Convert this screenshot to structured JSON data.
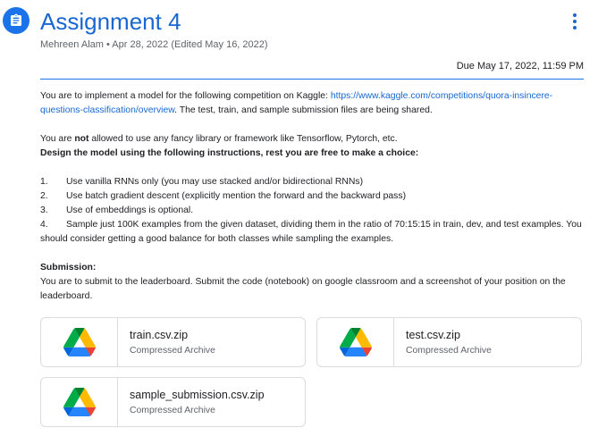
{
  "header": {
    "title": "Assignment 4",
    "meta": "Mehreen Alam • Apr 28, 2022 (Edited May 16, 2022)",
    "due": "Due May 17, 2022, 11:59 PM"
  },
  "body": {
    "intro_pre": "You are to implement a model for the following competition on Kaggle: ",
    "intro_link": "https://www.kaggle.com/competitions/quora-insincere-questions-classification/overview",
    "intro_post": ". The test, train, and sample submission files are being shared.",
    "restrict_pre": "You are ",
    "restrict_bold": "not",
    "restrict_post": " allowed to use any fancy library or framework like Tensorflow, Pytorch, etc.",
    "design_heading": "Design the model using the following instructions, rest you are free to make a choice:",
    "list": [
      {
        "num": "1.",
        "text": "Use vanilla RNNs only (you may use stacked and/or bidirectional RNNs)"
      },
      {
        "num": "2.",
        "text": "Use batch gradient descent (explicitly mention the forward and the backward pass)"
      },
      {
        "num": "3.",
        "text": "Use of embeddings is optional."
      },
      {
        "num": "4.",
        "text": "Sample just 100K examples from the given dataset, dividing them in the ratio of 70:15:15 in train, dev, and test examples. You should consider getting a good balance for both classes while sampling the examples."
      }
    ],
    "submission_heading": "Submission:",
    "submission_text": "You are to submit to the leaderboard. Submit the code (notebook) on google classroom and a screenshot of your position on the leaderboard."
  },
  "attachments": [
    {
      "name": "train.csv.zip",
      "type": "Compressed Archive",
      "icon": "google-drive-icon"
    },
    {
      "name": "test.csv.zip",
      "type": "Compressed Archive",
      "icon": "google-drive-icon"
    },
    {
      "name": "sample_submission.csv.zip",
      "type": "Compressed Archive",
      "icon": "google-drive-icon"
    }
  ],
  "colors": {
    "accent": "#1967d2",
    "icon_bg": "#1a73e8",
    "drive_green": "#0f9d58",
    "drive_yellow": "#f4b400",
    "drive_blue": "#4285f4"
  }
}
